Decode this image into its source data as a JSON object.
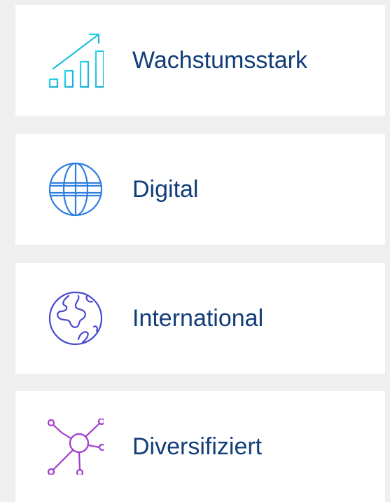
{
  "items": [
    {
      "label": "Wachstumsstark",
      "icon": "growth-chart-icon",
      "color": "#1fc6e0"
    },
    {
      "label": "Digital",
      "icon": "globe-icon",
      "color": "#2f7ee0"
    },
    {
      "label": "International",
      "icon": "earth-icon",
      "color": "#4a4ad0"
    },
    {
      "label": "Diversifiziert",
      "icon": "network-icon",
      "color": "#a03ccc"
    }
  ],
  "colors": {
    "background": "#efefef",
    "card": "#ffffff",
    "text": "#123d78"
  }
}
